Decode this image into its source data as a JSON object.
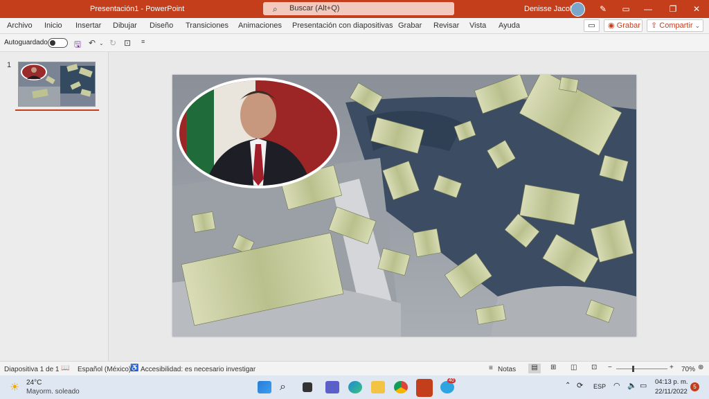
{
  "titlebar": {
    "title": "Presentación1  -  PowerPoint",
    "search_placeholder": "Buscar (Alt+Q)",
    "user_name": "Denisse Jacobo"
  },
  "ribbon": {
    "tabs": [
      "Archivo",
      "Inicio",
      "Insertar",
      "Dibujar",
      "Diseño",
      "Transiciones",
      "Animaciones",
      "Presentación con diapositivas",
      "Grabar",
      "Revisar",
      "Vista",
      "Ayuda"
    ],
    "grabar_label": "Grabar",
    "share_label": "Compartir"
  },
  "qat": {
    "autosave_label": "Autoguardado"
  },
  "slides_panel": {
    "slide_number": "1"
  },
  "statusbar": {
    "slide_info": "Diapositiva 1 de 1",
    "language": "Español (México)",
    "accessibility": "Accesibilidad: es necesario investigar",
    "notes": "Notas",
    "zoom": "70%"
  },
  "taskbar": {
    "weather_temp": "24°C",
    "weather_desc": "Mayorm. soleado",
    "language": "ESP",
    "time": "04:13 p. m.",
    "date": "22/11/2022",
    "notifications": "5",
    "telegram_badge": "40"
  }
}
